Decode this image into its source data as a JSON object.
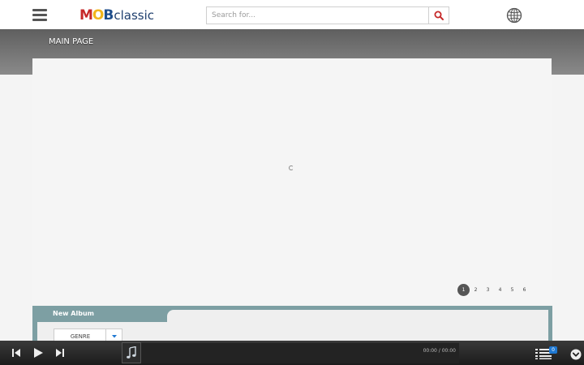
{
  "header": {
    "logo": {
      "m": "M",
      "o": "O",
      "b": "B",
      "rest": "classic"
    },
    "search": {
      "placeholder": "Search for..."
    },
    "icons": {
      "menu": "hamburger-menu-icon",
      "search": "search-icon",
      "language": "globe-icon"
    }
  },
  "banner": {
    "title": "MAIN PAGE"
  },
  "pagination": {
    "pages": [
      "1",
      "2",
      "3",
      "4",
      "5",
      "6"
    ],
    "active": "1"
  },
  "album_panel": {
    "title": "New Album",
    "genre_select": {
      "selected": "GENRE"
    }
  },
  "player": {
    "time": "00:00 / 00:00",
    "playlist_count": "0",
    "icons": {
      "prev": "skip-previous-icon",
      "play": "play-icon",
      "next": "skip-next-icon",
      "thumb": "music-note-icon",
      "playlist": "playlist-icon",
      "expand": "chevron-down-icon"
    }
  },
  "colors": {
    "accent_red": "#c62828",
    "logo_blue": "#1f4e8c",
    "panel_teal": "#7d9fa3",
    "badge_blue": "#1e78d2"
  }
}
